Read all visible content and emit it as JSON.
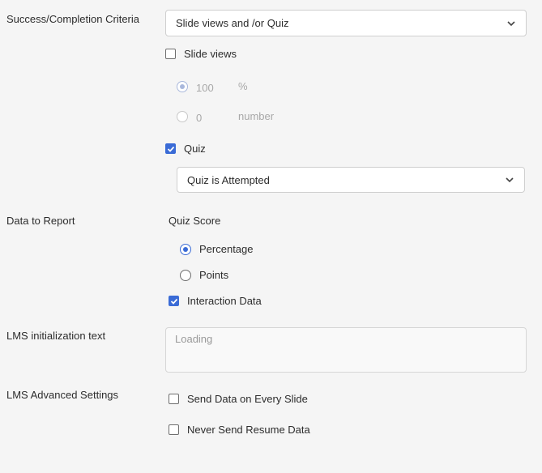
{
  "success": {
    "label": "Success/Completion Criteria",
    "dropdown_value": "Slide views and /or Quiz",
    "slide_views": {
      "label": "Slide views",
      "checked": false
    },
    "percent_option": {
      "value": "100",
      "unit": "%",
      "selected": true,
      "enabled": false
    },
    "number_option": {
      "value": "0",
      "unit": "number",
      "selected": false,
      "enabled": false
    },
    "quiz": {
      "label": "Quiz",
      "checked": true
    },
    "quiz_dropdown_value": "Quiz is Attempted"
  },
  "data_to_report": {
    "label": "Data to Report",
    "quiz_score_label": "Quiz Score",
    "percentage": {
      "label": "Percentage",
      "selected": true
    },
    "points": {
      "label": "Points",
      "selected": false
    },
    "interaction_data": {
      "label": "Interaction Data",
      "checked": true
    }
  },
  "lms_init": {
    "label": "LMS initialization text",
    "placeholder": "Loading"
  },
  "lms_advanced": {
    "label": "LMS Advanced Settings",
    "send_every_slide": {
      "label": "Send Data on Every Slide",
      "checked": false
    },
    "never_send_resume": {
      "label": "Never Send Resume Data",
      "checked": false
    }
  },
  "colors": {
    "accent": "#3a6bd6",
    "background": "#f5f5f5"
  },
  "icons": {
    "dropdown": "chevron-down-icon",
    "check": "checkmark-icon"
  }
}
